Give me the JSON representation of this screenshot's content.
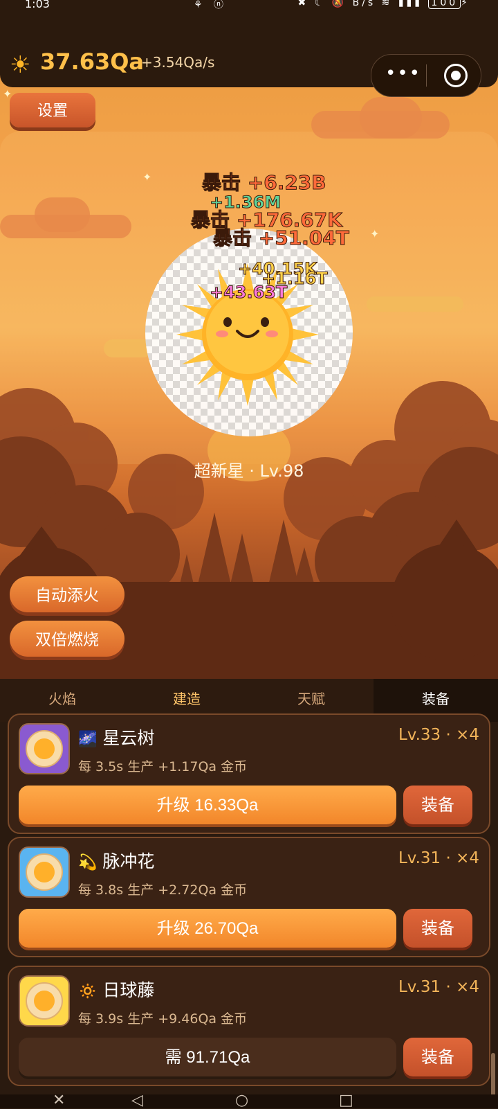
{
  "status": {
    "time": "1:03",
    "left_icons": "⚘ ⓝ",
    "right_icons": "✖ ☾ 🔕 B/s ≋ ▮▮▮",
    "battery": "100"
  },
  "header": {
    "currency": "37.63Qa",
    "rate": "+3.54Qa/s",
    "menu_dots": "•••"
  },
  "settings_label": "设置",
  "floating_texts": [
    {
      "text": "暴击 +6.23B",
      "color": "#ff6a3a"
    },
    {
      "text": "+1.36M",
      "color": "#5fd39a"
    },
    {
      "text": "暴击 +176.67K",
      "color": "#ff6a3a"
    },
    {
      "text": "暴击 +51.04T",
      "color": "#ff6a3a"
    },
    {
      "text": "+40.15K",
      "color": "#ffd24a"
    },
    {
      "text": "+1.16T",
      "color": "#ffd24a"
    },
    {
      "text": "+43.63T",
      "color": "#ff7ad9"
    }
  ],
  "star_label": "超新星 · Lv.98",
  "side_buttons": {
    "auto_fuel": "自动添火",
    "double_burn": "双倍燃烧"
  },
  "tabs": [
    {
      "label": "火焰"
    },
    {
      "label": "建造"
    },
    {
      "label": "天赋"
    },
    {
      "label": "装备"
    }
  ],
  "items": [
    {
      "emoji": "🌌",
      "name": "星云树",
      "level": "Lv.33 · ×4",
      "desc": "每 3.5s 生产 +1.17Qa 金币",
      "action": "升级 16.33Qa",
      "equip": "装备",
      "thumb_color": "#8a5ad0",
      "affordable": true
    },
    {
      "emoji": "💫",
      "name": "脉冲花",
      "level": "Lv.31 · ×4",
      "desc": "每 3.8s 生产 +2.72Qa 金币",
      "action": "升级 26.70Qa",
      "equip": "装备",
      "thumb_color": "#5ab4f0",
      "affordable": true
    },
    {
      "emoji": "🔅",
      "name": "日球藤",
      "level": "Lv.31 · ×4",
      "desc": "每 3.9s 生产 +9.46Qa 金币",
      "action": "需 91.71Qa",
      "equip": "装备",
      "thumb_color": "#ffd84a",
      "affordable": false
    }
  ],
  "nav": {
    "close": "✕",
    "back": "◁",
    "home": "○",
    "recent": "□"
  }
}
